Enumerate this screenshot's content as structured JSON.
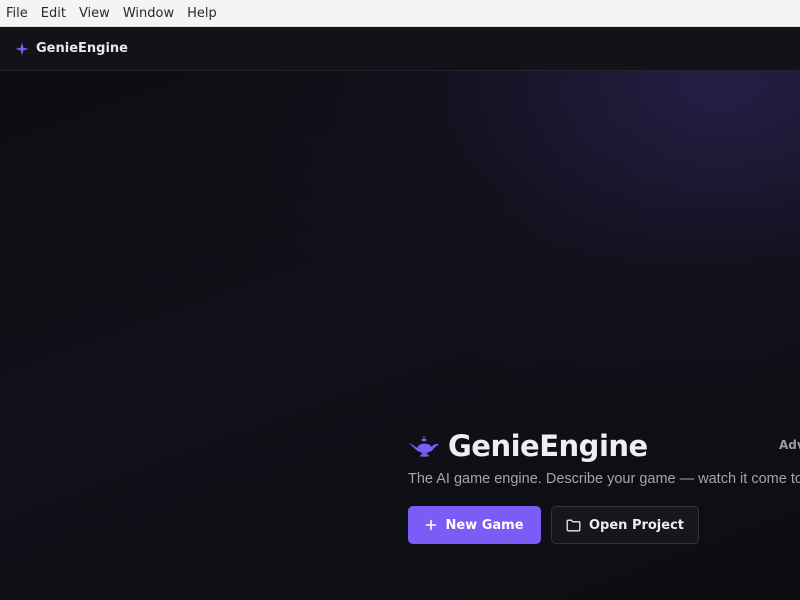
{
  "menubar": {
    "items": [
      "File",
      "Edit",
      "View",
      "Window",
      "Help"
    ]
  },
  "titlebar": {
    "app_name": "GenieEngine",
    "icon": "sparkle-icon"
  },
  "hero": {
    "icon": "genie-lamp-icon",
    "title": "GenieEngine",
    "adv_link": "Adv",
    "tagline": "The AI game engine. Describe your game — watch it come to li"
  },
  "actions": {
    "new_game": {
      "label": "New Game",
      "icon": "plus-icon"
    },
    "open_project": {
      "label": "Open Project",
      "icon": "folder-icon"
    }
  },
  "colors": {
    "accent": "#7b5cf6",
    "background": "#0d0d11",
    "menubar_bg": "#f5f4f2"
  }
}
